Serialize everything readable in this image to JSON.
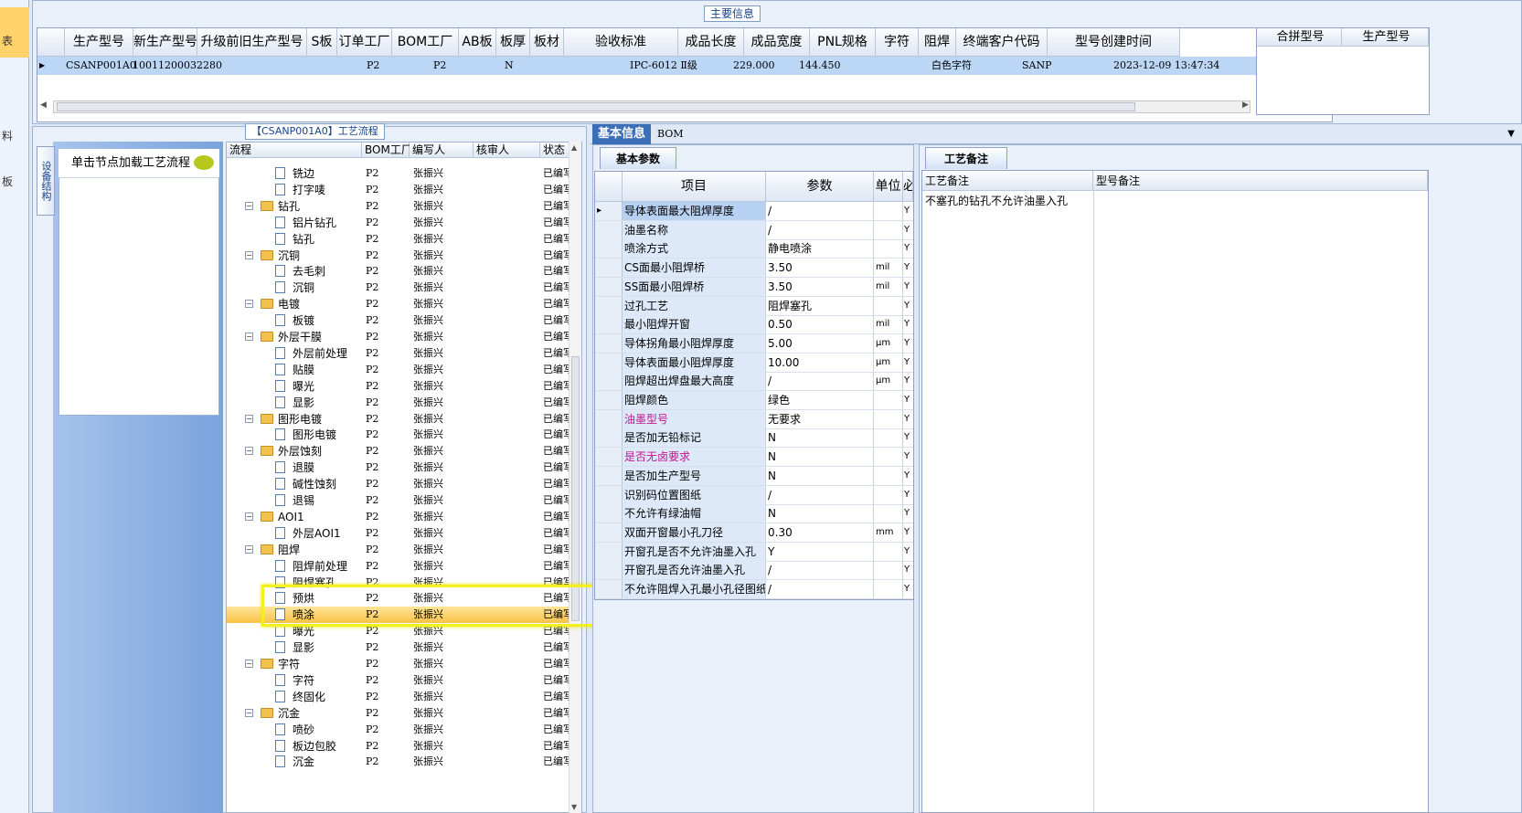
{
  "left_strip": {
    "items": [
      "表",
      "料",
      "板"
    ]
  },
  "main_info": {
    "title": "主要信息",
    "columns": [
      "生产型号",
      "新生产型号",
      "升级前旧生产型号",
      "S板",
      "订单工厂",
      "BOM工厂",
      "AB板",
      "板厚",
      "板材",
      "验收标准",
      "成品长度",
      "成品宽度",
      "PNL规格",
      "字符",
      "阻焊",
      "终端客户代码",
      "型号创建时间"
    ],
    "row": {
      "prod_model": "CSANP001A0",
      "new_model": "10011200032280",
      "order_factory": "P2",
      "bom_factory": "P2",
      "ab_board": "N",
      "standard": "IPC-6012 Ⅱ级",
      "length": "229.000",
      "width": "144.450",
      "char": "白色字符",
      "customer": "SANP",
      "created": "2023-12-09 13:47:34"
    },
    "side_columns": [
      "合拼型号",
      "生产型号"
    ]
  },
  "process": {
    "title": "【CSANP001A0】工艺流程",
    "side_tab": "设备结构",
    "load_hint": "单击节点加载工艺流程",
    "columns": [
      "流程",
      "BOM工厂",
      "编写人",
      "核审人",
      "状态"
    ],
    "rows": [
      {
        "name": "铣边",
        "level": 2,
        "bom": "P2",
        "writer": "张振兴",
        "status": "已编写"
      },
      {
        "name": "打字唛",
        "level": 2,
        "bom": "P2",
        "writer": "张振兴",
        "status": "已编写"
      },
      {
        "name": "钻孔",
        "level": 1,
        "bom": "P2",
        "writer": "张振兴",
        "status": "已编写"
      },
      {
        "name": "铝片钻孔",
        "level": 2,
        "bom": "P2",
        "writer": "张振兴",
        "status": "已编写"
      },
      {
        "name": "钻孔",
        "level": 2,
        "bom": "P2",
        "writer": "张振兴",
        "status": "已编写"
      },
      {
        "name": "沉铜",
        "level": 1,
        "bom": "P2",
        "writer": "张振兴",
        "status": "已编写"
      },
      {
        "name": "去毛刺",
        "level": 2,
        "bom": "P2",
        "writer": "张振兴",
        "status": "已编写"
      },
      {
        "name": "沉铜",
        "level": 2,
        "bom": "P2",
        "writer": "张振兴",
        "status": "已编写"
      },
      {
        "name": "电镀",
        "level": 1,
        "bom": "P2",
        "writer": "张振兴",
        "status": "已编写"
      },
      {
        "name": "板镀",
        "level": 2,
        "bom": "P2",
        "writer": "张振兴",
        "status": "已编写"
      },
      {
        "name": "外层干膜",
        "level": 1,
        "bom": "P2",
        "writer": "张振兴",
        "status": "已编写"
      },
      {
        "name": "外层前处理",
        "level": 2,
        "bom": "P2",
        "writer": "张振兴",
        "status": "已编写"
      },
      {
        "name": "贴膜",
        "level": 2,
        "bom": "P2",
        "writer": "张振兴",
        "status": "已编写"
      },
      {
        "name": "曝光",
        "level": 2,
        "bom": "P2",
        "writer": "张振兴",
        "status": "已编写"
      },
      {
        "name": "显影",
        "level": 2,
        "bom": "P2",
        "writer": "张振兴",
        "status": "已编写"
      },
      {
        "name": "图形电镀",
        "level": 1,
        "bom": "P2",
        "writer": "张振兴",
        "status": "已编写"
      },
      {
        "name": "图形电镀",
        "level": 2,
        "bom": "P2",
        "writer": "张振兴",
        "status": "已编写"
      },
      {
        "name": "外层蚀刻",
        "level": 1,
        "bom": "P2",
        "writer": "张振兴",
        "status": "已编写"
      },
      {
        "name": "退膜",
        "level": 2,
        "bom": "P2",
        "writer": "张振兴",
        "status": "已编写"
      },
      {
        "name": "碱性蚀刻",
        "level": 2,
        "bom": "P2",
        "writer": "张振兴",
        "status": "已编写"
      },
      {
        "name": "退锡",
        "level": 2,
        "bom": "P2",
        "writer": "张振兴",
        "status": "已编写"
      },
      {
        "name": "AOI1",
        "level": 1,
        "bom": "P2",
        "writer": "张振兴",
        "status": "已编写"
      },
      {
        "name": "外层AOI1",
        "level": 2,
        "bom": "P2",
        "writer": "张振兴",
        "status": "已编写"
      },
      {
        "name": "阻焊",
        "level": 1,
        "bom": "P2",
        "writer": "张振兴",
        "status": "已编写"
      },
      {
        "name": "阻焊前处理",
        "level": 2,
        "bom": "P2",
        "writer": "张振兴",
        "status": "已编写"
      },
      {
        "name": "阻焊塞孔",
        "level": 2,
        "bom": "P2",
        "writer": "张振兴",
        "status": "已编写"
      },
      {
        "name": "预烘",
        "level": 2,
        "bom": "P2",
        "writer": "张振兴",
        "status": "已编写"
      },
      {
        "name": "喷涂",
        "level": 2,
        "bom": "P2",
        "writer": "张振兴",
        "status": "已编写",
        "selected": true
      },
      {
        "name": "曝光",
        "level": 2,
        "bom": "P2",
        "writer": "张振兴",
        "status": "已编写"
      },
      {
        "name": "显影",
        "level": 2,
        "bom": "P2",
        "writer": "张振兴",
        "status": "已编写"
      },
      {
        "name": "字符",
        "level": 1,
        "bom": "P2",
        "writer": "张振兴",
        "status": "已编写"
      },
      {
        "name": "字符",
        "level": 2,
        "bom": "P2",
        "writer": "张振兴",
        "status": "已编写"
      },
      {
        "name": "终固化",
        "level": 2,
        "bom": "P2",
        "writer": "张振兴",
        "status": "已编写"
      },
      {
        "name": "沉金",
        "level": 1,
        "bom": "P2",
        "writer": "张振兴",
        "status": "已编写"
      },
      {
        "name": "喷砂",
        "level": 2,
        "bom": "P2",
        "writer": "张振兴",
        "status": "已编写"
      },
      {
        "name": "板边包胶",
        "level": 2,
        "bom": "P2",
        "writer": "张振兴",
        "status": "已编写"
      },
      {
        "name": "沉金",
        "level": 2,
        "bom": "P2",
        "writer": "张振兴",
        "status": "已编写"
      }
    ]
  },
  "tabs": [
    "基本信息",
    "BOM"
  ],
  "basic_params": {
    "subtab": "基本参数",
    "columns": [
      "项目",
      "参数",
      "单位",
      "必"
    ],
    "rows": [
      {
        "item": "导体表面最大阻焊厚度",
        "value": "/",
        "unit": "",
        "flag": "Y"
      },
      {
        "item": "油墨名称",
        "value": "/",
        "unit": "",
        "flag": "Y"
      },
      {
        "item": "喷涂方式",
        "value": "静电喷涂",
        "unit": "",
        "flag": "Y"
      },
      {
        "item": "CS面最小阻焊桥",
        "value": "3.50",
        "unit": "mil",
        "flag": "Y"
      },
      {
        "item": "SS面最小阻焊桥",
        "value": "3.50",
        "unit": "mil",
        "flag": "Y"
      },
      {
        "item": "过孔工艺",
        "value": "阻焊塞孔",
        "unit": "",
        "flag": "Y"
      },
      {
        "item": "最小阻焊开窗",
        "value": "0.50",
        "unit": "mil",
        "flag": "Y"
      },
      {
        "item": "导体拐角最小阻焊厚度",
        "value": "5.00",
        "unit": "μm",
        "flag": "Y"
      },
      {
        "item": "导体表面最小阻焊厚度",
        "value": "10.00",
        "unit": "μm",
        "flag": "Y"
      },
      {
        "item": "阻焊超出焊盘最大高度",
        "value": "/",
        "unit": "μm",
        "flag": "Y"
      },
      {
        "item": "阻焊颜色",
        "value": "绿色",
        "unit": "",
        "flag": "Y"
      },
      {
        "item": "油墨型号",
        "value": "无要求",
        "unit": "",
        "flag": "Y",
        "magenta": true
      },
      {
        "item": "是否加无铅标记",
        "value": "N",
        "unit": "",
        "flag": "Y"
      },
      {
        "item": "是否无卤要求",
        "value": "N",
        "unit": "",
        "flag": "Y",
        "magenta": true
      },
      {
        "item": "是否加生产型号",
        "value": "N",
        "unit": "",
        "flag": "Y"
      },
      {
        "item": "识别码位置图纸",
        "value": "/",
        "unit": "",
        "flag": "Y"
      },
      {
        "item": "不允许有绿油帽",
        "value": "N",
        "unit": "",
        "flag": "Y"
      },
      {
        "item": "双面开窗最小孔刀径",
        "value": "0.30",
        "unit": "mm",
        "flag": "Y"
      },
      {
        "item": "开窗孔是否不允许油墨入孔",
        "value": "Y",
        "unit": "",
        "flag": "Y"
      },
      {
        "item": "开窗孔是否允许油墨入孔",
        "value": "/",
        "unit": "",
        "flag": "Y"
      },
      {
        "item": "不允许阻焊入孔最小孔径图纸",
        "value": "/",
        "unit": "",
        "flag": "Y"
      }
    ]
  },
  "remarks": {
    "subtab": "工艺备注",
    "columns": [
      "工艺备注",
      "型号备注"
    ],
    "process_note": "不塞孔的钻孔不允许油墨入孔",
    "model_note": ""
  },
  "colors": {
    "accent": "#15428b",
    "selected_row": "#bcd6f5",
    "highlight": "#f4f020",
    "magenta": "#c0158f"
  }
}
